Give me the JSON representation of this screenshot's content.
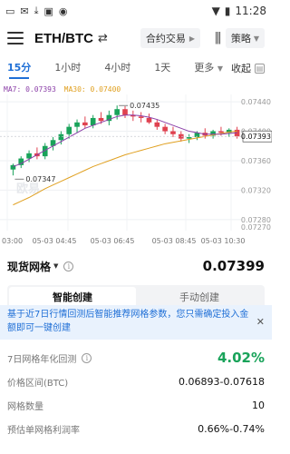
{
  "status_bar": {
    "time": "11:28"
  },
  "header": {
    "pair": "ETH/BTC",
    "contract_label": "合约交易",
    "strategy_label": "策略"
  },
  "timeframes": {
    "tabs": [
      "15分",
      "1小时",
      "4小时",
      "1天",
      "更多"
    ],
    "active_index": 0,
    "collapse_label": "收起"
  },
  "chart": {
    "ma7_label": "MA7: 0.07393",
    "ma30_label": "MA30: 0.07400",
    "high_label": "0.07435",
    "low_label": "0.07347",
    "current_price_tag": "0.07393",
    "watermark": "欧易",
    "y_ticks": [
      "0.07440",
      "0.07400",
      "0.07393",
      "0.07360",
      "0.07320",
      "0.07280",
      "0.07270"
    ],
    "x_ticks": [
      "03:00",
      "05-03 04:45",
      "05-03 06:45",
      "05-03 08:45",
      "05-03 10:30"
    ]
  },
  "chart_data": {
    "type": "candlestick",
    "candles": [
      {
        "o": 0.07348,
        "h": 0.07356,
        "l": 0.0734,
        "c": 0.07354
      },
      {
        "o": 0.07354,
        "h": 0.07366,
        "l": 0.0735,
        "c": 0.07363
      },
      {
        "o": 0.07363,
        "h": 0.07374,
        "l": 0.07358,
        "c": 0.0737
      },
      {
        "o": 0.0737,
        "h": 0.07378,
        "l": 0.07362,
        "c": 0.07366
      },
      {
        "o": 0.07366,
        "h": 0.07384,
        "l": 0.07362,
        "c": 0.0738
      },
      {
        "o": 0.0738,
        "h": 0.07392,
        "l": 0.07374,
        "c": 0.07388
      },
      {
        "o": 0.07388,
        "h": 0.074,
        "l": 0.07382,
        "c": 0.07396
      },
      {
        "o": 0.07396,
        "h": 0.0741,
        "l": 0.0739,
        "c": 0.07406
      },
      {
        "o": 0.07406,
        "h": 0.07416,
        "l": 0.07398,
        "c": 0.07412
      },
      {
        "o": 0.07412,
        "h": 0.0742,
        "l": 0.07404,
        "c": 0.07408
      },
      {
        "o": 0.07408,
        "h": 0.07422,
        "l": 0.07404,
        "c": 0.07418
      },
      {
        "o": 0.07418,
        "h": 0.07426,
        "l": 0.0741,
        "c": 0.07414
      },
      {
        "o": 0.07414,
        "h": 0.07428,
        "l": 0.07408,
        "c": 0.07422
      },
      {
        "o": 0.07422,
        "h": 0.07435,
        "l": 0.07416,
        "c": 0.0743
      },
      {
        "o": 0.0743,
        "h": 0.07434,
        "l": 0.07418,
        "c": 0.07422
      },
      {
        "o": 0.07422,
        "h": 0.07428,
        "l": 0.07414,
        "c": 0.0742
      },
      {
        "o": 0.0742,
        "h": 0.07426,
        "l": 0.07412,
        "c": 0.07418
      },
      {
        "o": 0.07418,
        "h": 0.07424,
        "l": 0.0741,
        "c": 0.07412
      },
      {
        "o": 0.07412,
        "h": 0.07416,
        "l": 0.07402,
        "c": 0.07406
      },
      {
        "o": 0.07406,
        "h": 0.0741,
        "l": 0.07396,
        "c": 0.074
      },
      {
        "o": 0.074,
        "h": 0.07406,
        "l": 0.07392,
        "c": 0.07396
      },
      {
        "o": 0.07396,
        "h": 0.074,
        "l": 0.07386,
        "c": 0.0739
      },
      {
        "o": 0.0739,
        "h": 0.07396,
        "l": 0.07384,
        "c": 0.07392
      },
      {
        "o": 0.07392,
        "h": 0.074,
        "l": 0.07388,
        "c": 0.07398
      },
      {
        "o": 0.07398,
        "h": 0.07404,
        "l": 0.0739,
        "c": 0.07394
      },
      {
        "o": 0.07394,
        "h": 0.07402,
        "l": 0.0739,
        "c": 0.074
      },
      {
        "o": 0.074,
        "h": 0.07406,
        "l": 0.07394,
        "c": 0.07398
      },
      {
        "o": 0.07398,
        "h": 0.07404,
        "l": 0.07392,
        "c": 0.07402
      },
      {
        "o": 0.07402,
        "h": 0.07406,
        "l": 0.0739,
        "c": 0.07393
      }
    ],
    "ma7": [
      0.07352,
      0.07356,
      0.07362,
      0.07368,
      0.07374,
      0.0738,
      0.07386,
      0.07392,
      0.07398,
      0.07404,
      0.07408,
      0.07412,
      0.07416,
      0.0742,
      0.07422,
      0.07422,
      0.07421,
      0.07419,
      0.07416,
      0.07412,
      0.07408,
      0.07404,
      0.074,
      0.07398,
      0.07396,
      0.07396,
      0.07396,
      0.07397,
      0.07398
    ],
    "ma30": [
      0.073,
      0.07305,
      0.0731,
      0.07316,
      0.07322,
      0.07327,
      0.07332,
      0.07337,
      0.07342,
      0.07347,
      0.07352,
      0.07356,
      0.0736,
      0.07364,
      0.07368,
      0.07371,
      0.07374,
      0.07377,
      0.0738,
      0.07383,
      0.07385,
      0.07387,
      0.07389,
      0.07391,
      0.07393,
      0.07395,
      0.07397,
      0.07399,
      0.074
    ],
    "ylim": [
      0.07265,
      0.0745
    ]
  },
  "grid": {
    "title": "现货网格",
    "price": "0.07399",
    "tabs": [
      "智能创建",
      "手动创建"
    ],
    "active_tab": 0,
    "notice": "基于近7日行情回测后智能推荐网格参数，您只需确定投入金额即可一键创建",
    "stats": [
      {
        "label": "7日网格年化回测",
        "value": "4.02%"
      },
      {
        "label": "价格区间(BTC)",
        "value": "0.06893-0.07618"
      },
      {
        "label": "网格数量",
        "value": "10"
      },
      {
        "label": "预估单网格利润率",
        "value": "0.66%-0.74%"
      }
    ]
  },
  "colors": {
    "up": "#19a35a",
    "down": "#e0414f",
    "ma7": "#8b3fa8",
    "ma30": "#e0a020",
    "accent": "#1f6fd6"
  }
}
